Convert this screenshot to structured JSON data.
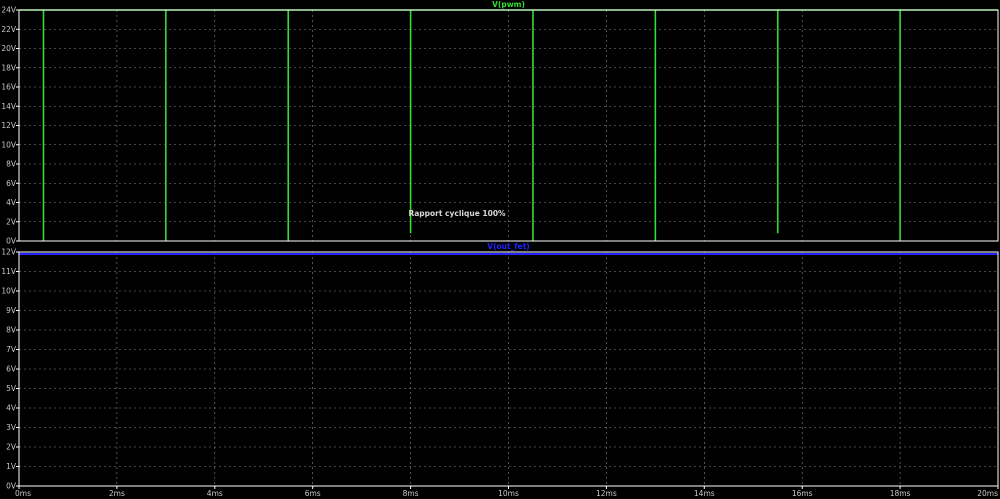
{
  "chart_data": [
    {
      "type": "line",
      "title": "V(pwm)",
      "x_unit": "ms",
      "xlim": [
        0,
        20
      ],
      "ylim": [
        0,
        24
      ],
      "ytick_labels": [
        "0V",
        "2V",
        "4V",
        "6V",
        "8V",
        "10V",
        "12V",
        "14V",
        "16V",
        "18V",
        "20V",
        "22V",
        "24V"
      ],
      "series": [
        {
          "name": "V(pwm)",
          "color": "#33dd33",
          "x": [
            0,
            0.5,
            0.5,
            0.5,
            3,
            3,
            3,
            5.5,
            5.5,
            5.5,
            8,
            8,
            8,
            10.5,
            10.5,
            10.5,
            13,
            13,
            13,
            15.5,
            15.5,
            15.5,
            18,
            18,
            18,
            20.5,
            20.5,
            20.5,
            21
          ],
          "y": [
            24,
            24,
            0,
            24,
            24,
            0,
            24,
            24,
            0,
            24,
            24,
            0.8,
            24,
            24,
            0,
            24,
            24,
            0,
            24,
            24,
            0.8,
            24,
            24,
            0,
            24,
            24,
            0,
            24,
            24
          ]
        }
      ],
      "annotation": "Rapport cyclique 100%"
    },
    {
      "type": "line",
      "title": "V(out_fet)",
      "x_unit": "ms",
      "xlim": [
        0,
        20
      ],
      "ylim": [
        0,
        12
      ],
      "ytick_labels": [
        "0V",
        "1V",
        "2V",
        "3V",
        "4V",
        "5V",
        "6V",
        "7V",
        "8V",
        "9V",
        "10V",
        "11V",
        "12V"
      ],
      "xtick_labels": [
        "0ms",
        "2ms",
        "4ms",
        "6ms",
        "8ms",
        "10ms",
        "12ms",
        "14ms",
        "16ms",
        "18ms",
        "20ms"
      ],
      "series": [
        {
          "name": "V(out_fet)",
          "color": "#2222ff",
          "x": [
            0,
            20
          ],
          "y": [
            11.9,
            11.9
          ]
        }
      ]
    }
  ]
}
